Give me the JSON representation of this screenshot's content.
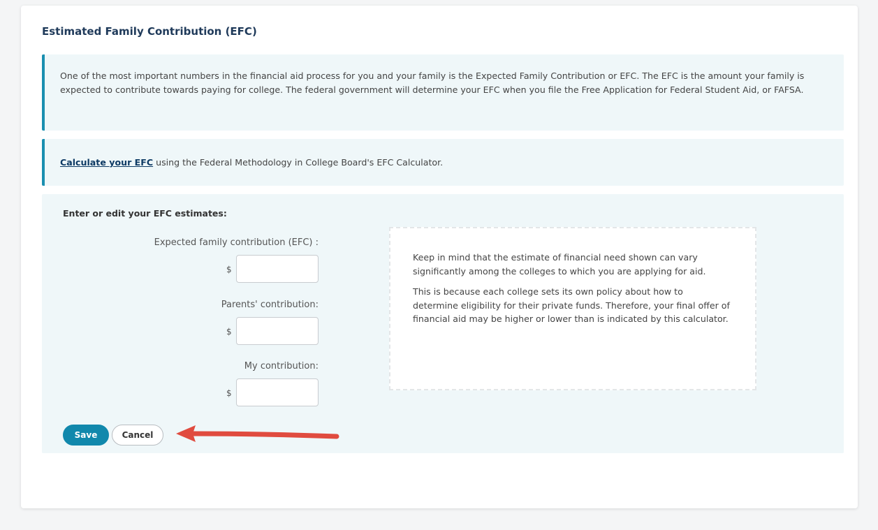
{
  "section": {
    "title": "Estimated Family Contribution (EFC)"
  },
  "intro": {
    "text": "One of the most important numbers in the financial aid process for you and your family is the Expected Family Contribution or EFC. The EFC is the amount your family is expected to contribute towards paying for college. The federal government will determine your EFC when you file the Free Application for Federal Student Aid, or FAFSA."
  },
  "calculator": {
    "link_text": "Calculate your EFC",
    "rest_text": " using the Federal Methodology in College Board's EFC Calculator."
  },
  "form": {
    "heading": "Enter or edit your EFC estimates:",
    "currency_symbol": "$",
    "fields": [
      {
        "label": "Expected family contribution (EFC) :",
        "value": ""
      },
      {
        "label": "Parents' contribution:",
        "value": ""
      },
      {
        "label": "My contribution:",
        "value": ""
      }
    ],
    "note": {
      "paragraph_1": "Keep in mind that the estimate of financial need shown can vary significantly among the colleges to which you are applying for aid.",
      "paragraph_2": "This is because each college sets its own policy about how to determine eligibility for their private funds. Therefore, your final offer of financial aid may be higher or lower than is indicated by this calculator."
    },
    "save_label": "Save",
    "cancel_label": "Cancel"
  },
  "colors": {
    "accent": "#1188ac",
    "panel_bg": "#eff7f9",
    "title": "#1f3a5a",
    "link": "#0d3a64",
    "annotation_arrow": "#e04b3f"
  },
  "icons": {
    "annotation": "red-arrow-left-icon"
  }
}
